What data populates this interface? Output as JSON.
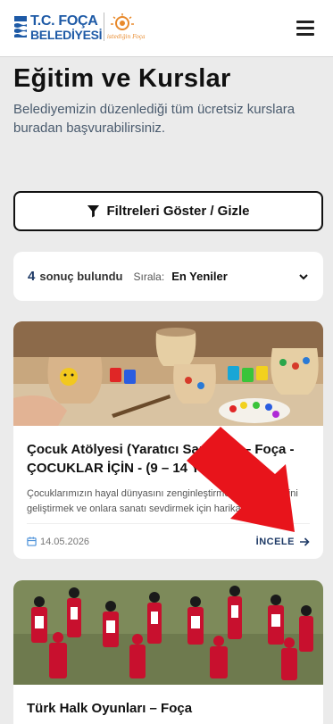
{
  "header": {
    "logo_line1": "T.C. FOÇA",
    "logo_line2": "BELEDİYESİ",
    "logo_tagline": "istediğin Foça",
    "menu_icon": "hamburger-menu-icon"
  },
  "page": {
    "title": "Eğitim ve Kurslar",
    "subtitle": "Belediyemizin düzenlediği tüm ücretsiz kurslara buradan başvurabilirsiniz."
  },
  "filter": {
    "label": "Filtreleri Göster / Gizle",
    "icon": "filter-funnel-icon"
  },
  "results": {
    "count": "4",
    "found_label": "sonuç bulundu",
    "sort_label": "Sırala:",
    "sort_value": "En Yeniler",
    "sort_icon": "chevron-down-icon"
  },
  "cards": [
    {
      "title": "Çocuk Atölyesi (Yaratıcı Sanatlar) – Foça - ÇOCUKLAR İÇİN - (9 – 14 Yaş)",
      "description": "Çocuklarımızın hayal dünyasını zenginleştirmek, el becerilerini geliştirmek ve onlara sanatı sevdirmek için harika bir fırsat!",
      "date": "14.05.2026",
      "link_label": "İNCELE",
      "image": "painted-clay-pots-art-workshop"
    },
    {
      "title": "Türk Halk Oyunları – Foça",
      "description": "",
      "image": "folk-dancers-in-red-costumes"
    }
  ],
  "colors": {
    "accent": "#1e3a66",
    "brand_blue": "#1e5aa6",
    "brand_orange": "#e8892b",
    "overlay_arrow": "#e8141b",
    "background": "#ebebeb"
  }
}
